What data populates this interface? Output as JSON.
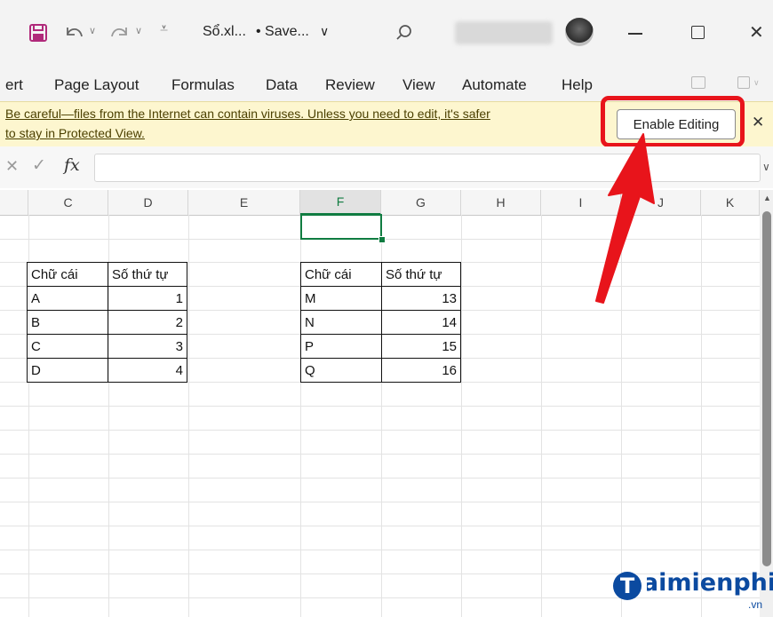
{
  "titlebar": {
    "file_name": "Sổ.xl...",
    "save_status": "• Save...",
    "dropdown_chevron": "∨",
    "icons": [
      "save-icon",
      "undo-icon",
      "redo-icon",
      "customize-toolbar-icon",
      "search-icon",
      "avatar",
      "minimize-icon",
      "maximize-icon",
      "close-icon"
    ]
  },
  "ribbon": {
    "tabs": [
      "ert",
      "Page Layout",
      "Formulas",
      "Data",
      "Review",
      "View",
      "Automate",
      "Help"
    ]
  },
  "message_bar": {
    "line1": "Be careful—files from the Internet can contain viruses. Unless you need to edit, it's safer",
    "line2": "to stay in Protected View.",
    "enable_button": "Enable Editing",
    "close": "✕"
  },
  "formula_bar": {
    "fx": "fx",
    "value": ""
  },
  "columns": [
    "C",
    "D",
    "E",
    "F",
    "G",
    "H",
    "I",
    "J",
    "K"
  ],
  "selected_column": "F",
  "table1": {
    "headers": [
      "Chữ cái",
      "Số thứ tự"
    ],
    "rows": [
      [
        "A",
        "1"
      ],
      [
        "B",
        "2"
      ],
      [
        "C",
        "3"
      ],
      [
        "D",
        "4"
      ]
    ]
  },
  "table2": {
    "headers": [
      "Chữ cái",
      "Số thứ tự"
    ],
    "rows": [
      [
        "M",
        "13"
      ],
      [
        "N",
        "14"
      ],
      [
        "P",
        "15"
      ],
      [
        "Q",
        "16"
      ]
    ]
  },
  "watermark": {
    "logo": "Taimienphi",
    "suffix": ".vn"
  },
  "colors": {
    "highlight_red": "#e8141b",
    "excel_green": "#107c41",
    "message_bar": "#fdf6cf"
  }
}
